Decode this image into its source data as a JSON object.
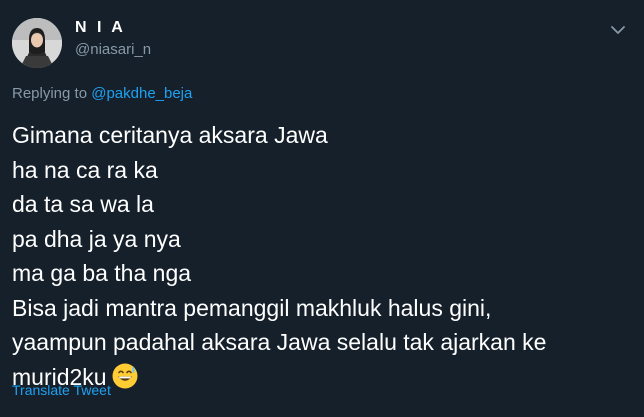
{
  "tweet": {
    "display_name": "N I A",
    "handle": "@niasari_n",
    "replying_prefix": "Replying to",
    "replying_mention": "@pakdhe_beja",
    "lines": [
      "Gimana ceritanya aksara Jawa",
      "ha na ca ra ka",
      "da ta sa wa la",
      "pa dha ja ya nya",
      "ma ga ba tha nga",
      "Bisa jadi mantra pemanggil makhluk halus gini,",
      "yaampun padahal aksara Jawa selalu tak ajarkan ke",
      "murid2ku"
    ],
    "emoji": "grinning-face-with-sweat",
    "translate_label": "Translate Tweet",
    "more_icon": "chevron-down-icon"
  },
  "colors": {
    "background": "#15202b",
    "primary_text": "#ffffff",
    "secondary_text": "#8899a6",
    "accent": "#1da1f2"
  }
}
